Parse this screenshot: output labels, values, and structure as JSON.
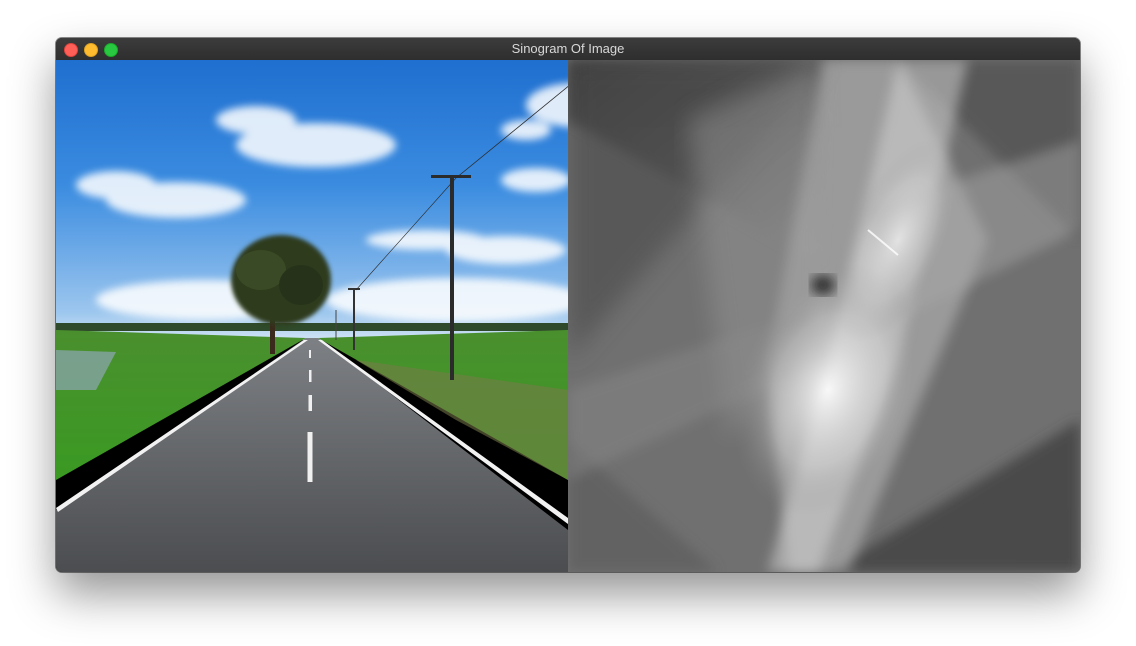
{
  "window": {
    "title": "Sinogram Of Image",
    "controls": [
      "close",
      "minimize",
      "zoom"
    ]
  },
  "panels": {
    "left": {
      "content": "road-landscape-photo"
    },
    "right": {
      "content": "sinogram"
    }
  },
  "colors": {
    "titlebar": "#2f2f2f",
    "close": "#ff5f57",
    "minimize": "#febc2e",
    "zoom": "#28c840",
    "sky": "#2e7fd6",
    "grass": "#3f9e2a",
    "asphalt": "#55575a"
  }
}
